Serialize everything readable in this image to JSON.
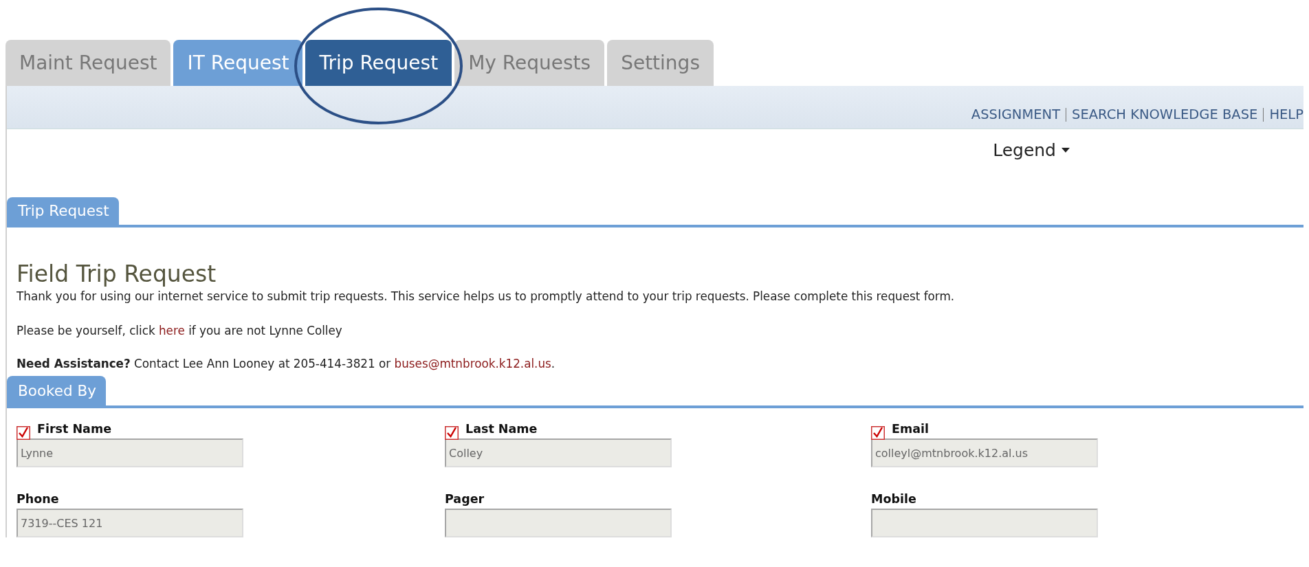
{
  "tabs": [
    {
      "label": "Maint Request",
      "selected": false,
      "highlighted": false,
      "circled": false
    },
    {
      "label": "IT Request",
      "selected": false,
      "highlighted": true,
      "circled": false
    },
    {
      "label": "Trip Request",
      "selected": true,
      "highlighted": false,
      "circled": true
    },
    {
      "label": "My Requests",
      "selected": false,
      "highlighted": false,
      "circled": false
    },
    {
      "label": "Settings",
      "selected": false,
      "highlighted": false,
      "circled": false
    }
  ],
  "toolbar_links": [
    "ASSIGNMENT",
    "SEARCH KNOWLEDGE BASE",
    "HELP"
  ],
  "legend": {
    "label": "Legend",
    "expanded": false
  },
  "section_tab": "Trip Request",
  "heading": "Field Trip Request",
  "intro": "Thank you for using our internet service to submit trip requests. This service helps us to promptly attend to your trip requests. Please complete this request form.",
  "identity_line": {
    "before": "Please be yourself, click ",
    "link": "here",
    "after": " if you are not Lynne Colley"
  },
  "assistance_line": {
    "before": "**Need Assistance?** Contact Lee Ann Looney at 205-414-3821 or ",
    "link": "buses@mtnbrook.k12.al.us",
    "after": "."
  },
  "booked_by": {
    "title": "Booked By",
    "fields": [
      {
        "label": "First Name",
        "required": true,
        "value": "Lynne"
      },
      {
        "label": "Last Name",
        "required": true,
        "value": "Colley"
      },
      {
        "label": "Email",
        "required": true,
        "value": "colleyl@mtnbrook.k12.al.us"
      },
      {
        "label": "Phone",
        "required": false,
        "value": "7319--CES 121"
      },
      {
        "label": "Pager",
        "required": false
      },
      {
        "label": "Mobile",
        "required": false
      }
    ]
  }
}
